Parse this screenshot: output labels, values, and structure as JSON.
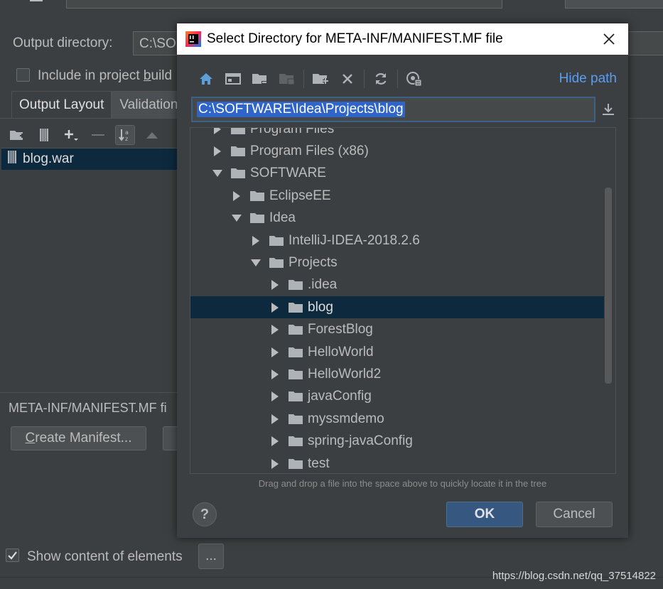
{
  "background": {
    "output_label": "Output directory:",
    "output_value": "C:\\SOF",
    "include_build_label_pre": "Include in project ",
    "include_build_label_u": "b",
    "include_build_label_post": "uild",
    "tabs": [
      {
        "label": "Output Layout",
        "active": true
      },
      {
        "label": "Validation",
        "active": false
      }
    ],
    "list_item": "blog.war",
    "manifest_label": "META-INF/MANIFEST.MF fi",
    "create_manifest_u": "C",
    "create_manifest_rest": "reate Manifest...",
    "show_content_label": "Show content of elements",
    "show_content_checked": true,
    "ellipsis_button": "..."
  },
  "dialog": {
    "title": "Select Directory for META-INF/MANIFEST.MF file",
    "hide_path": "Hide path",
    "path": "C:\\SOFTWARE\\Idea\\Projects\\blog",
    "tree": [
      {
        "label": "Program Files",
        "depth": 0,
        "expanded": false,
        "partial": true
      },
      {
        "label": "Program Files (x86)",
        "depth": 0,
        "expanded": false
      },
      {
        "label": "SOFTWARE",
        "depth": 0,
        "expanded": true
      },
      {
        "label": "EclipseEE",
        "depth": 1,
        "expanded": false
      },
      {
        "label": "Idea",
        "depth": 1,
        "expanded": true
      },
      {
        "label": "IntelliJ-IDEA-2018.2.6",
        "depth": 2,
        "expanded": false
      },
      {
        "label": "Projects",
        "depth": 2,
        "expanded": true
      },
      {
        "label": ".idea",
        "depth": 3,
        "expanded": false
      },
      {
        "label": "blog",
        "depth": 3,
        "expanded": false,
        "selected": true
      },
      {
        "label": "ForestBlog",
        "depth": 3,
        "expanded": false
      },
      {
        "label": "HelloWorld",
        "depth": 3,
        "expanded": false
      },
      {
        "label": "HelloWorld2",
        "depth": 3,
        "expanded": false
      },
      {
        "label": "javaConfig",
        "depth": 3,
        "expanded": false
      },
      {
        "label": "myssmdemo",
        "depth": 3,
        "expanded": false
      },
      {
        "label": "spring-javaConfig",
        "depth": 3,
        "expanded": false
      },
      {
        "label": "test",
        "depth": 3,
        "expanded": false
      }
    ],
    "hint": "Drag and drop a file into the space above to quickly locate it in the tree",
    "help": "?",
    "ok": "OK",
    "cancel": "Cancel"
  },
  "watermark": "https://blog.csdn.net/qq_37514822",
  "colors": {
    "accent_link": "#589df6",
    "selection": "#0d293e",
    "path_highlight": "#2f65ca",
    "ok_button": "#365880",
    "panel_bg": "#3c3f41"
  }
}
